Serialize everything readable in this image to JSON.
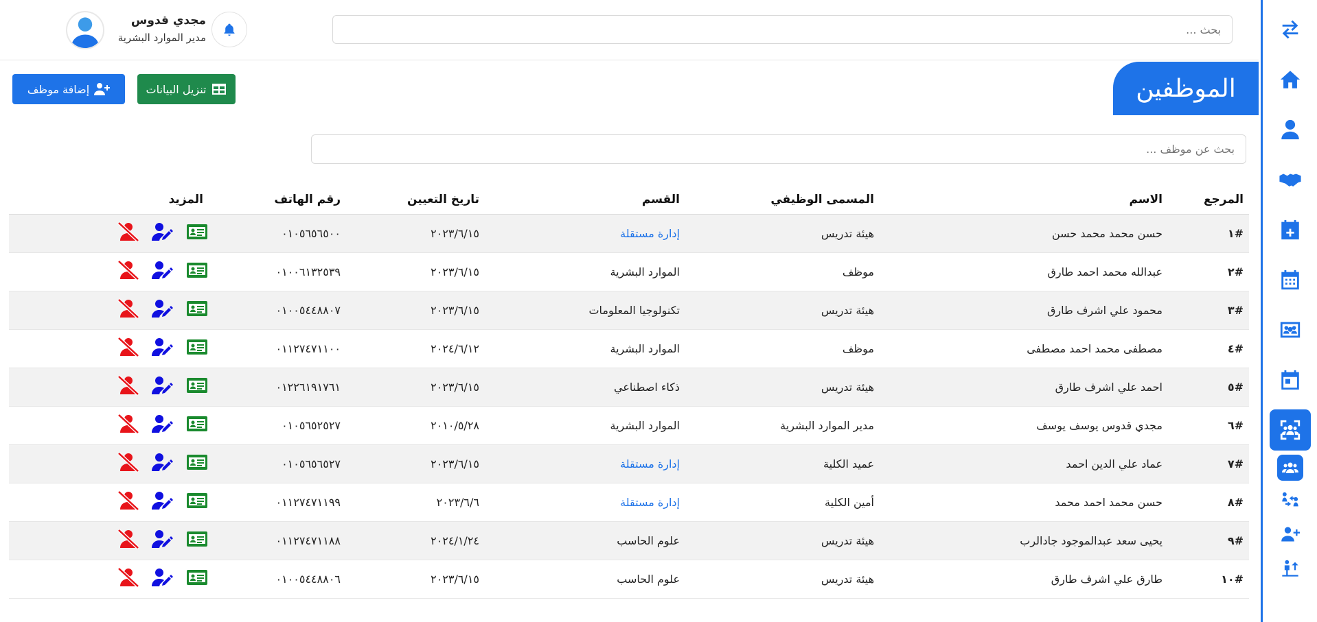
{
  "topbar": {
    "search_placeholder": "بحث ...",
    "user_name": "مجدي قدوس",
    "user_role": "مدير الموارد البشرية"
  },
  "page": {
    "title": "الموظفين",
    "add_button": "إضافة موظف",
    "download_button": "تنزيل البيانات",
    "employee_search_placeholder": "بحث عن موظف ..."
  },
  "sidebar_icons": [
    "swap-icon",
    "home-icon",
    "user-icon",
    "handshake-icon",
    "calendar-plus-icon",
    "calendar-icon",
    "users-rectangle-icon",
    "calendar-day-icon",
    "users-viewfinder-icon",
    "users-icon",
    "people-arrows-icon",
    "user-plus-icon",
    "person-arrow-up-icon"
  ],
  "table": {
    "headers": {
      "ref": "المرجع",
      "name": "الاسم",
      "title": "المسمى الوظيفي",
      "dept": "القسم",
      "date": "تاريخ التعيين",
      "phone": "رقم الهاتف",
      "more": "المزيد"
    },
    "rows": [
      {
        "ref": "#١",
        "name": "حسن محمد محمد حسن",
        "title": "هيئة تدريس",
        "dept": "إدارة مستقلة",
        "dept_link": true,
        "date": "٢٠٢٣/٦/١٥",
        "phone": "٠١٠٥٦٥٦٥٠٠"
      },
      {
        "ref": "#٢",
        "name": "عبدالله محمد احمد طارق",
        "title": "موظف",
        "dept": "الموارد البشرية",
        "dept_link": false,
        "date": "٢٠٢٣/٦/١٥",
        "phone": "٠١٠٠٦١٣٢٥٣٩"
      },
      {
        "ref": "#٣",
        "name": "محمود علي اشرف طارق",
        "title": "هيئة تدريس",
        "dept": "تكنولوجيا المعلومات",
        "dept_link": false,
        "date": "٢٠٢٣/٦/١٥",
        "phone": "٠١٠٠٥٤٤٨٨٠٧"
      },
      {
        "ref": "#٤",
        "name": "مصطفى محمد احمد مصطفى",
        "title": "موظف",
        "dept": "الموارد البشرية",
        "dept_link": false,
        "date": "٢٠٢٤/٦/١٢",
        "phone": "٠١١٢٧٤٧١١٠٠"
      },
      {
        "ref": "#٥",
        "name": "احمد علي اشرف طارق",
        "title": "هيئة تدريس",
        "dept": "ذكاء اصطناعي",
        "dept_link": false,
        "date": "٢٠٢٣/٦/١٥",
        "phone": "٠١٢٢٦١٩١٧٦١"
      },
      {
        "ref": "#٦",
        "name": "مجدي قدوس يوسف يوسف",
        "title": "مدير الموارد البشرية",
        "dept": "الموارد البشرية",
        "dept_link": false,
        "date": "٢٠١٠/٥/٢٨",
        "phone": "٠١٠٥٦٥٢٥٢٧"
      },
      {
        "ref": "#٧",
        "name": "عماد علي الدين احمد",
        "title": "عميد الكلية",
        "dept": "إدارة مستقلة",
        "dept_link": true,
        "date": "٢٠٢٣/٦/١٥",
        "phone": "٠١٠٥٦٥٦٥٢٧"
      },
      {
        "ref": "#٨",
        "name": "حسن محمد احمد محمد",
        "title": "أمين الكلية",
        "dept": "إدارة مستقلة",
        "dept_link": true,
        "date": "٢٠٢٣/٦/٦",
        "phone": "٠١١٢٧٤٧١١٩٩"
      },
      {
        "ref": "#٩",
        "name": "يحيى سعد عبدالموجود جادالرب",
        "title": "هيئة تدريس",
        "dept": "علوم الحاسب",
        "dept_link": false,
        "date": "٢٠٢٤/١/٢٤",
        "phone": "٠١١٢٧٤٧١١٨٨"
      },
      {
        "ref": "#١٠",
        "name": "طارق علي اشرف طارق",
        "title": "هيئة تدريس",
        "dept": "علوم الحاسب",
        "dept_link": false,
        "date": "٢٠٢٣/٦/١٥",
        "phone": "٠١٠٠٥٤٤٨٨٠٦"
      }
    ]
  },
  "colors": {
    "primary": "#1e73e8",
    "download_green": "#1f8a4c",
    "icon_green": "#1a8a2e",
    "icon_blue": "#1010e0",
    "icon_red": "#e8141a"
  }
}
